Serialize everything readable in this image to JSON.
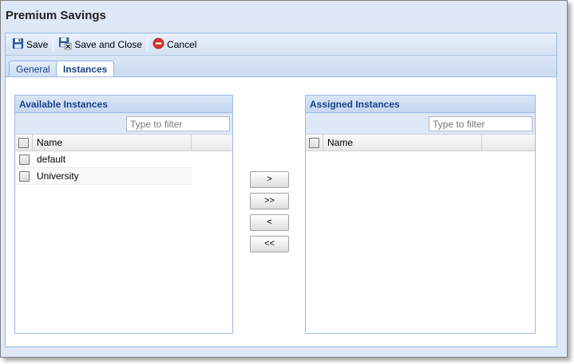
{
  "window": {
    "title": "Premium Savings"
  },
  "toolbar": {
    "save_label": "Save",
    "save_close_label": "Save and Close",
    "cancel_label": "Cancel"
  },
  "tabs": [
    {
      "label": "General",
      "active": false
    },
    {
      "label": "Instances",
      "active": true
    }
  ],
  "available": {
    "title": "Available Instances",
    "filter_placeholder": "Type to filter",
    "columns": [
      "Name"
    ],
    "rows": [
      "default",
      "University"
    ]
  },
  "assigned": {
    "title": "Assigned Instances",
    "filter_placeholder": "Type to filter",
    "columns": [
      "Name"
    ],
    "rows": []
  },
  "move_buttons": {
    "add": ">",
    "add_all": ">>",
    "remove": "<",
    "remove_all": "<<"
  },
  "colors": {
    "accent_text": "#15428b",
    "panel_border": "#99bbe8",
    "window_bg": "#dfe8f6"
  }
}
